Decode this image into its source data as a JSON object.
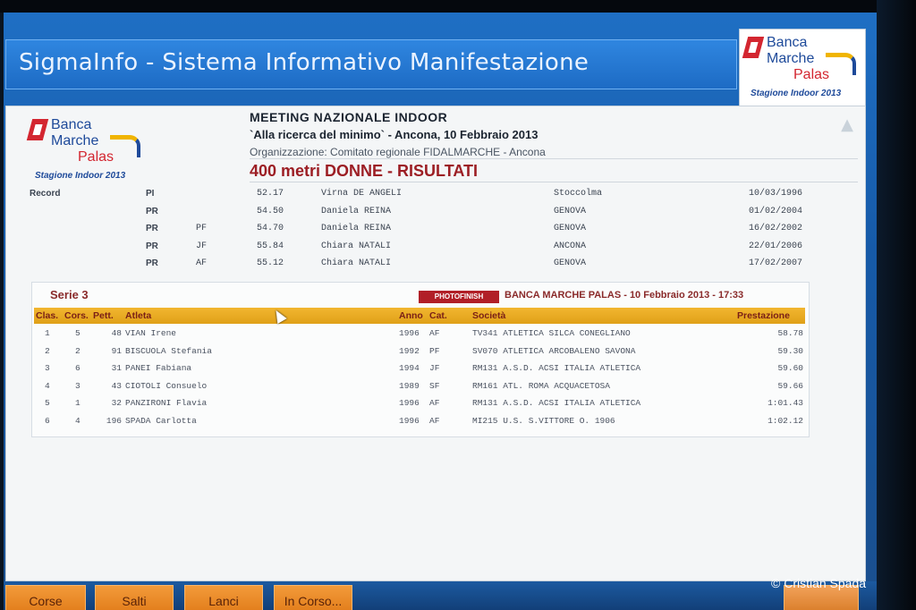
{
  "app": {
    "title": "SigmaInfo - Sistema Informativo Manifestazione"
  },
  "logo": {
    "line1": "Banca",
    "line2": "Marche",
    "line3": "Palas",
    "subtitle": "Stagione Indoor 2013"
  },
  "meeting": {
    "title": "MEETING NAZIONALE INDOOR",
    "subtitle": "`Alla ricerca del minimo` - Ancona, 10 Febbraio 2013",
    "organization": "Organizzazione: Comitato regionale FIDALMARCHE - Ancona",
    "event": "400 metri DONNE - RISULTATI"
  },
  "records": {
    "label": "Record",
    "rows": [
      {
        "type": "PI",
        "cat": "",
        "time": "52.17",
        "name": "Virna DE ANGELI",
        "city": "Stoccolma",
        "date": "10/03/1996"
      },
      {
        "type": "PR",
        "cat": "",
        "time": "54.50",
        "name": "Daniela REINA",
        "city": "GENOVA",
        "date": "01/02/2004"
      },
      {
        "type": "PR",
        "cat": "PF",
        "time": "54.70",
        "name": "Daniela REINA",
        "city": "GENOVA",
        "date": "16/02/2002"
      },
      {
        "type": "PR",
        "cat": "JF",
        "time": "55.84",
        "name": "Chiara NATALI",
        "city": "ANCONA",
        "date": "22/01/2006"
      },
      {
        "type": "PR",
        "cat": "AF",
        "time": "55.12",
        "name": "Chiara NATALI",
        "city": "GENOVA",
        "date": "17/02/2007"
      }
    ]
  },
  "series": {
    "title": "Serie 3",
    "photofinish": "PHOTOFINISH",
    "info": "BANCA MARCHE PALAS - 10 Febbraio 2013 - 17:33",
    "headers": {
      "clas": "Clas.",
      "cors": "Cors.",
      "pett": "Pett.",
      "atleta": "Atleta",
      "anno": "Anno",
      "cat": "Cat.",
      "societa": "Società",
      "prestazione": "Prestazione"
    },
    "rows": [
      {
        "clas": "1",
        "cors": "5",
        "pett": "48",
        "atleta": "VIAN Irene",
        "anno": "1996",
        "cat": "AF",
        "societa": "TV341 ATLETICA SILCA CONEGLIANO",
        "prestazione": "58.78"
      },
      {
        "clas": "2",
        "cors": "2",
        "pett": "91",
        "atleta": "BISCUOLA Stefania",
        "anno": "1992",
        "cat": "PF",
        "societa": "SV070 ATLETICA ARCOBALENO SAVONA",
        "prestazione": "59.30"
      },
      {
        "clas": "3",
        "cors": "6",
        "pett": "31",
        "atleta": "PANEI Fabiana",
        "anno": "1994",
        "cat": "JF",
        "societa": "RM131 A.S.D. ACSI ITALIA ATLETICA",
        "prestazione": "59.60"
      },
      {
        "clas": "4",
        "cors": "3",
        "pett": "43",
        "atleta": "CIOTOLI Consuelo",
        "anno": "1989",
        "cat": "SF",
        "societa": "RM161 ATL. ROMA ACQUACETOSA",
        "prestazione": "59.66"
      },
      {
        "clas": "5",
        "cors": "1",
        "pett": "32",
        "atleta": "PANZIRONI Flavia",
        "anno": "1996",
        "cat": "AF",
        "societa": "RM131 A.S.D. ACSI ITALIA ATLETICA",
        "prestazione": "1:01.43"
      },
      {
        "clas": "6",
        "cors": "4",
        "pett": "196",
        "atleta": "SPADA Carlotta",
        "anno": "1996",
        "cat": "AF",
        "societa": "MI215 U.S. S.VITTORE O. 1906",
        "prestazione": "1:02.12"
      }
    ]
  },
  "nav": {
    "corse": "Corse",
    "salti": "Salti",
    "lanci": "Lanci",
    "in_corso": "In Corso..."
  },
  "watermark": "© Cristian Spada",
  "colors": {
    "accent_blue": "#1d6bc4",
    "header_orange": "#e0a018",
    "event_red": "#9c1e24",
    "button_orange": "#e07a18"
  }
}
